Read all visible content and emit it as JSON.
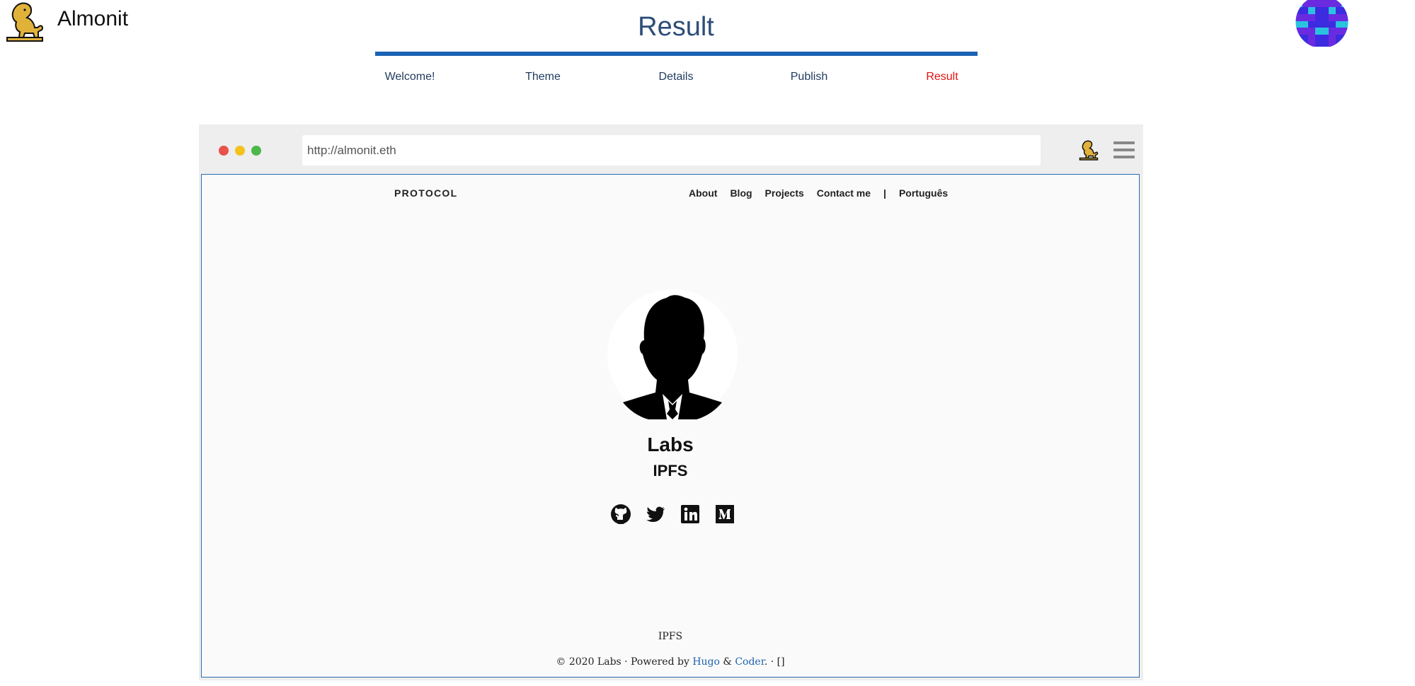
{
  "app": {
    "brand_name": "Almonit",
    "page_title": "Result"
  },
  "wizard": {
    "progress_fraction": 1.0,
    "steps": [
      "Welcome!",
      "Theme",
      "Details",
      "Publish",
      "Result"
    ],
    "active_step": "Result"
  },
  "browser": {
    "url": "http://almonit.eth",
    "dot_colors": [
      "#e8534a",
      "#f4c11d",
      "#4db84a"
    ]
  },
  "site": {
    "brand": "PROTOCOL",
    "nav": [
      "About",
      "Blog",
      "Projects",
      "Contact me",
      "|",
      "Português"
    ],
    "profile_name": "Labs",
    "profile_subtitle": "IPFS",
    "socials": [
      "github-icon",
      "twitter-icon",
      "linkedin-icon",
      "medium-icon"
    ],
    "footer_line1": "IPFS",
    "footer": {
      "prefix": "© 2020 Labs · Powered by ",
      "link1": "Hugo",
      "amp": " & ",
      "link2": "Coder",
      "suffix": ". · []"
    }
  },
  "colors": {
    "accent": "#1a63b5",
    "active_step": "#e0120f",
    "title": "#2d4d78",
    "link": "#1f62ac",
    "logo_gold": "#e1b23a"
  }
}
